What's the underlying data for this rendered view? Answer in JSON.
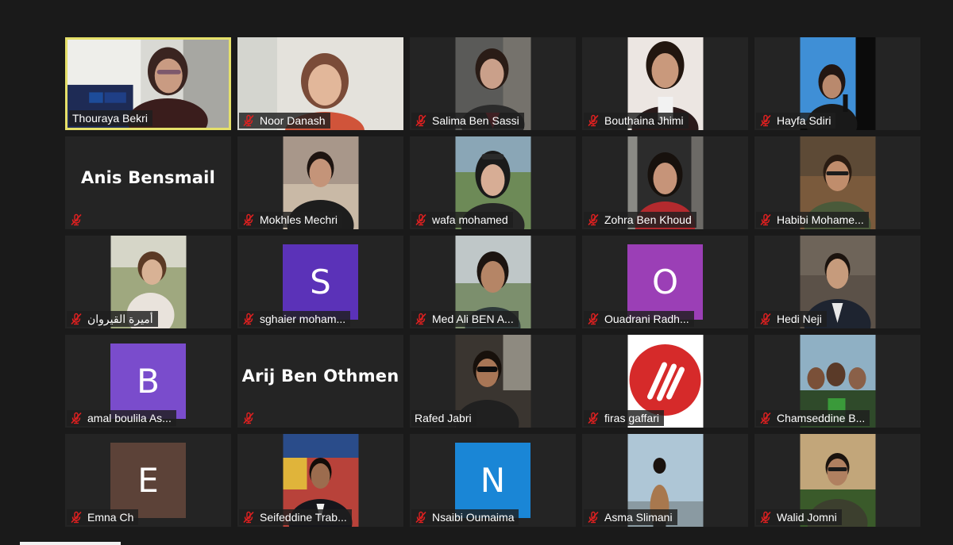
{
  "colors": {
    "background": "#1a1a1a",
    "tile": "#242424",
    "active_speaker_border": "#e5e06a",
    "mute_icon": "#e02020"
  },
  "participants": [
    {
      "name": "Thouraya Bekri",
      "muted": false
    },
    {
      "name": "Noor Danash",
      "muted": true
    },
    {
      "name": "Salima Ben Sassi",
      "muted": true
    },
    {
      "name": "Bouthaina Jhimi",
      "muted": true
    },
    {
      "name": "Hayfa Sdiri",
      "muted": true
    },
    {
      "name": "Anis Bensmail",
      "muted": true
    },
    {
      "name": "Mokhles Mechri",
      "muted": true
    },
    {
      "name": "wafa mohamed",
      "muted": true
    },
    {
      "name": "Zohra Ben Khoud",
      "muted": true
    },
    {
      "name": "Habibi Mohame...",
      "muted": true
    },
    {
      "name": "أميرة القيروان",
      "muted": true
    },
    {
      "name": "sghaier moham...",
      "muted": true,
      "avatar_letter": "S"
    },
    {
      "name": "Med Ali BEN A...",
      "muted": true
    },
    {
      "name": "Ouadrani Radh...",
      "muted": true,
      "avatar_letter": "O"
    },
    {
      "name": "Hedi Neji",
      "muted": true
    },
    {
      "name": "amal boulila As...",
      "muted": true,
      "avatar_letter": "B"
    },
    {
      "name": "Arij Ben Othmen",
      "muted": true
    },
    {
      "name": "Rafed Jabri",
      "muted": false
    },
    {
      "name": "firas gaffari",
      "muted": true
    },
    {
      "name": "Chamseddine B...",
      "muted": true
    },
    {
      "name": "Emna Ch",
      "muted": true,
      "avatar_letter": "E"
    },
    {
      "name": "Seifeddine Trab...",
      "muted": true
    },
    {
      "name": "Nsaibi Oumaima",
      "muted": true,
      "avatar_letter": "N"
    },
    {
      "name": "Asma Slimani",
      "muted": true
    },
    {
      "name": "Walid Jomni",
      "muted": true
    }
  ],
  "name_only_tiles": {
    "anis": "Anis Bensmail",
    "arij": "Arij Ben Othmen"
  }
}
